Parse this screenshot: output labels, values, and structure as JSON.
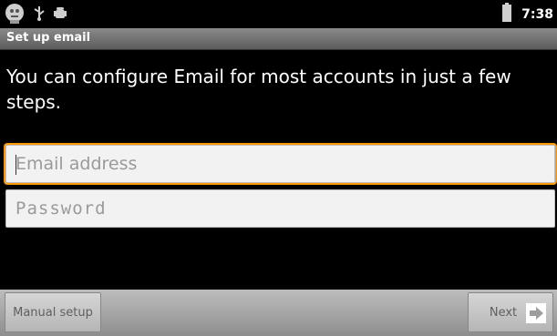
{
  "status": {
    "time": "7:38",
    "icons": [
      "android-robot-icon",
      "usb-icon",
      "debug-android-icon",
      "battery-icon"
    ]
  },
  "titlebar": {
    "title": "Set up email"
  },
  "main": {
    "intro": "You can configure Email for most accounts in just a few steps.",
    "email_field": {
      "placeholder": "Email address",
      "value": ""
    },
    "password_field": {
      "placeholder": "Password",
      "value": ""
    }
  },
  "buttons": {
    "manual_setup": "Manual setup",
    "next": "Next"
  },
  "colors": {
    "focus": "#ff9800",
    "background": "#000000"
  }
}
